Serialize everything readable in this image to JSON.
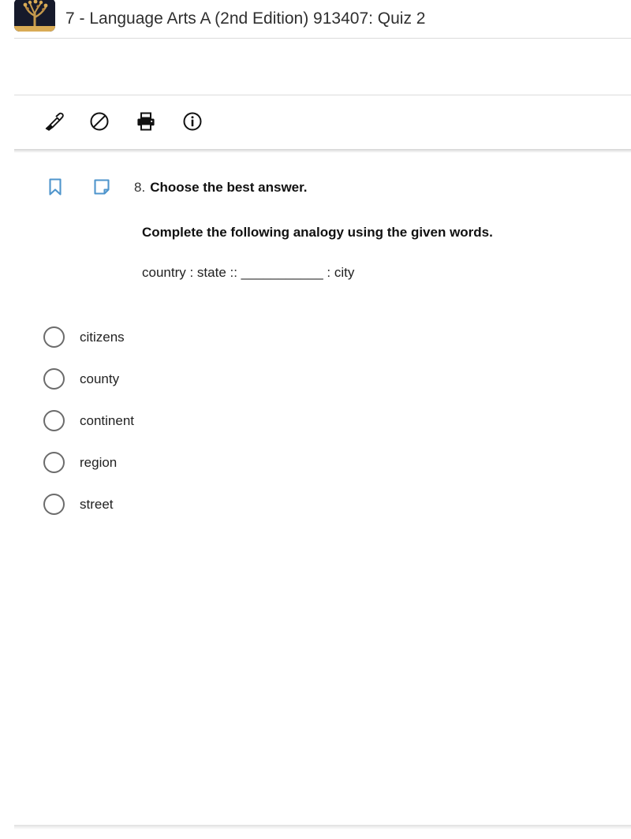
{
  "header": {
    "logo_icon": "tree-logo-icon",
    "title": "7 - Language Arts A (2nd Edition) 913407: Quiz 2"
  },
  "toolbar": {
    "buttons": [
      {
        "name": "highlighter",
        "icon": "highlighter-icon",
        "label": "Highlight"
      },
      {
        "name": "no-mark",
        "icon": "prohibited-icon",
        "label": "Clear Highlight"
      },
      {
        "name": "print",
        "icon": "printer-icon",
        "label": "Print"
      },
      {
        "name": "info",
        "icon": "info-circle-icon",
        "label": "Info"
      }
    ]
  },
  "question": {
    "bookmark_icon": "bookmark-icon",
    "note_icon": "note-icon",
    "number": "8.",
    "title": "Choose the best answer.",
    "instruction": "Complete the following analogy using the given words.",
    "analogy": "country : state :: ___________ : city",
    "options": [
      {
        "label": "citizens",
        "selected": false
      },
      {
        "label": "county",
        "selected": false
      },
      {
        "label": "continent",
        "selected": false
      },
      {
        "label": "region",
        "selected": false
      },
      {
        "label": "street",
        "selected": false
      }
    ]
  },
  "colors": {
    "accent_blue": "#4f95cc",
    "logo_gold": "#d9ab55",
    "logo_navy": "#161a2b",
    "text_dark": "#222222",
    "rule": "#dcdcdc"
  }
}
